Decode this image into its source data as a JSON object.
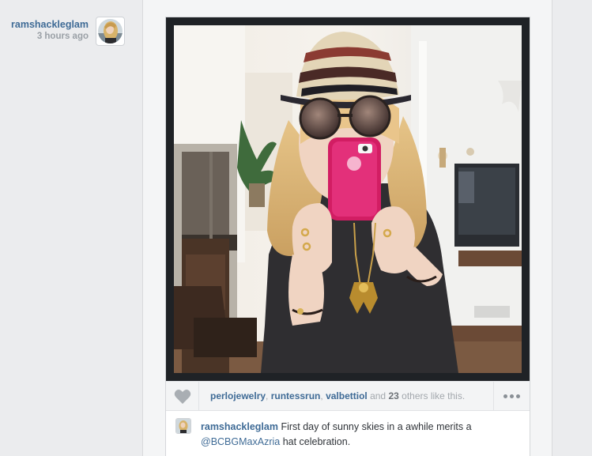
{
  "post": {
    "username": "ramshackleglam",
    "time_ago": "3 hours ago",
    "likes": {
      "users": [
        "perlojewelry",
        "runtessrun",
        "valbettiol"
      ],
      "separator": ", ",
      "and_text": " and ",
      "count": "23",
      "suffix": " others like this."
    },
    "caption": {
      "author": "ramshackleglam",
      "text_before": " First day of sunny skies in a awhile merits a ",
      "mention": "@BCBGMaxAzria",
      "text_after": " hat celebration."
    }
  },
  "icons": {
    "like": "heart-icon",
    "more": "more-options-icon"
  },
  "colors": {
    "link": "#3f6b96",
    "muted": "#a3a8ad",
    "phone_case": "#d21d63"
  }
}
